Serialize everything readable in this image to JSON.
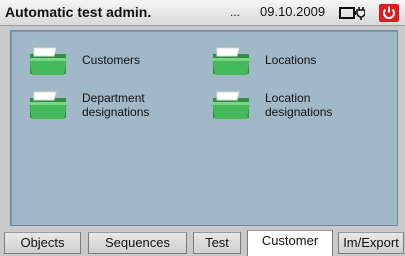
{
  "window": {
    "title": "Automatic test admin.",
    "overflow_indicator": "...",
    "date": "09.10.2009"
  },
  "status_icons": {
    "battery_icon": "battery-plug-icon",
    "power_icon": "power-icon",
    "power_color": "#e21c1c"
  },
  "content": {
    "background_color": "#a0b8c8",
    "items": [
      {
        "label": "Customers",
        "icon": "folder-icon"
      },
      {
        "label": "Locations",
        "icon": "folder-icon"
      },
      {
        "label": "Department\ndesignations",
        "icon": "folder-icon"
      },
      {
        "label": "Location\ndesignations",
        "icon": "folder-icon"
      }
    ]
  },
  "tabs": [
    {
      "label": "Objects",
      "active": false
    },
    {
      "label": "Sequences",
      "active": false
    },
    {
      "label": "Test",
      "active": false
    },
    {
      "label": "Customer",
      "active": true
    },
    {
      "label": "Im/Export",
      "active": false
    }
  ]
}
